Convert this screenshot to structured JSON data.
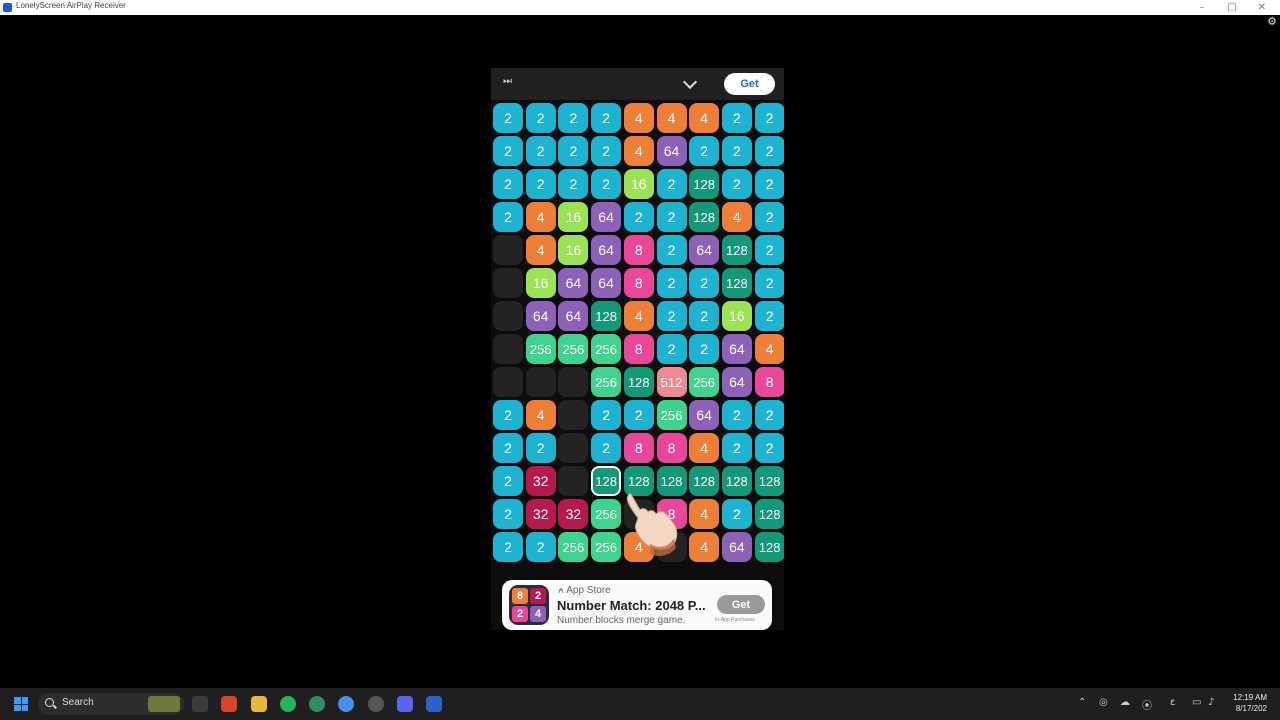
{
  "window": {
    "title": "LonelyScreen AirPlay Receiver"
  },
  "phone_header": {
    "get_label": "Get"
  },
  "board": {
    "rows": [
      [
        "2",
        "2",
        "2",
        "2",
        "4",
        "4",
        "4",
        "2",
        "2"
      ],
      [
        "2",
        "2",
        "2",
        "2",
        "4",
        "64",
        "2",
        "2",
        "2"
      ],
      [
        "2",
        "2",
        "2",
        "2",
        "16",
        "2",
        "128",
        "2",
        "2"
      ],
      [
        "2",
        "4",
        "16",
        "64",
        "2",
        "2",
        "128",
        "4",
        "2"
      ],
      [
        "",
        "4",
        "16",
        "64",
        "8",
        "2",
        "64",
        "128",
        "2"
      ],
      [
        "",
        "16",
        "64",
        "64",
        "8",
        "2",
        "2",
        "128",
        "2"
      ],
      [
        "",
        "64",
        "64",
        "128",
        "4",
        "2",
        "2",
        "16",
        "2"
      ],
      [
        "",
        "256",
        "256",
        "256",
        "8",
        "2",
        "2",
        "64",
        "4"
      ],
      [
        "",
        "",
        "",
        "256",
        "128",
        "512",
        "256",
        "64",
        "8"
      ],
      [
        "2",
        "4",
        "",
        "2",
        "2",
        "256",
        "64",
        "2",
        "2"
      ],
      [
        "2",
        "2",
        "",
        "2",
        "8",
        "8",
        "4",
        "2",
        "2"
      ],
      [
        "2",
        "32",
        "",
        "128",
        "128",
        "128",
        "128",
        "128",
        "128"
      ],
      [
        "2",
        "32",
        "32",
        "256",
        "",
        "8",
        "4",
        "2",
        "128"
      ],
      [
        "2",
        "2",
        "256",
        "256",
        "4",
        "",
        "4",
        "64",
        "128"
      ]
    ],
    "selected": {
      "row": 11,
      "col": 3
    },
    "tile_colors": {
      "2": "#1fb3d2",
      "4": "#ee7f36",
      "8": "#e8479a",
      "16": "#9be255",
      "32": "#b5194f",
      "64": "#8e61b8",
      "128": "#14987a",
      "256": "#3ed48e",
      "512": "#ef8a93"
    },
    "empty_color": "#232323"
  },
  "ad": {
    "store": "App Store",
    "title": "Number Match: 2048 P...",
    "subtitle": "Number blocks merge game.",
    "get_label": "Get",
    "fine_print": "In-App Purchases",
    "icon_tiles": [
      "8",
      "2",
      "2",
      "4"
    ]
  },
  "taskbar": {
    "search_label": "Search",
    "time": "12:19 AM",
    "date": "8/17/202"
  }
}
